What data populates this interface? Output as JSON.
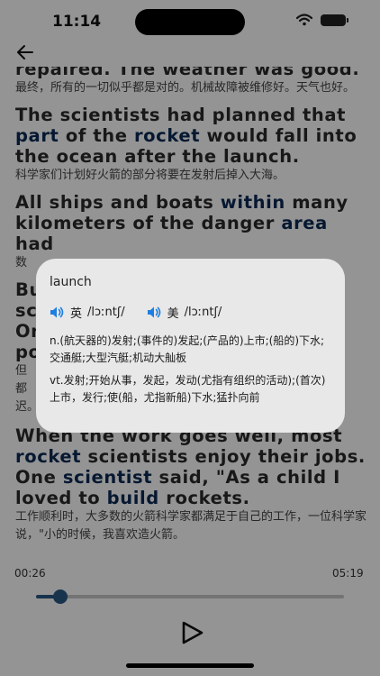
{
  "status": {
    "time": "11:14"
  },
  "paragraphs": [
    {
      "en": [
        [
          "repaired. The weather was good.",
          false
        ]
      ],
      "zh": "最终，所有的一切似乎都是对的。机械故障被维修好。天气也好。"
    },
    {
      "en": [
        [
          "The scientists had planned that ",
          false
        ],
        [
          "part",
          true
        ],
        [
          " of the ",
          false
        ],
        [
          "rocket",
          true
        ],
        [
          " would fall into the ocean after the launch.",
          false
        ]
      ],
      "zh": "科学家们计划好火箭的部分将要在发射后掉入大海。"
    },
    {
      "en": [
        [
          "All ships and boats ",
          false
        ],
        [
          "within",
          true
        ],
        [
          " many kilometers of the danger ",
          false
        ],
        [
          "area",
          true
        ],
        [
          " had",
          false
        ]
      ],
      "zh": "数"
    },
    {
      "en": [
        [
          "Bu",
          false
        ]
      ],
      "zh": ""
    },
    {
      "en": [
        [
          "sc",
          false
        ]
      ],
      "zh": ""
    },
    {
      "en": [
        [
          "On",
          false
        ]
      ],
      "zh": ""
    },
    {
      "en": [
        [
          "po",
          false
        ]
      ],
      "zh": "但都迟。"
    },
    {
      "en": [
        [
          "When the work goes well, most ",
          false
        ],
        [
          "rocket",
          true
        ],
        [
          " scientists enjoy their jobs. One ",
          false
        ],
        [
          "scientist",
          true
        ],
        [
          " said, \"As a child I loved to ",
          false
        ],
        [
          "build",
          true
        ],
        [
          " rockets.",
          false
        ]
      ],
      "zh": "工作顺利时，大多数的火箭科学家都满足于自己的工作，一位科学家说，\"小的时候，我喜欢造火箭。"
    }
  ],
  "player": {
    "current_time": "00:26",
    "total_time": "05:19",
    "progress": 0.08
  },
  "dictionary": {
    "word": "launch",
    "uk": {
      "label": "英",
      "ipa": "/lɔːntʃ/"
    },
    "us": {
      "label": "美",
      "ipa": "/lɔːntʃ/"
    },
    "definitions": [
      "n.(航天器的)发射;(事件的)发起;(产品的)上市;(船的)下水;交通艇;大型汽艇;机动大舢板",
      "vt.发射;开始从事，发起，发动(尤指有组织的活动);(首次)上市，发行;使(船，尤指新船)下水;猛扑向前"
    ]
  },
  "colors": {
    "accent": "#2a5a86",
    "keyword": "#0b2a55",
    "popup_bg": "#e8e8e8"
  },
  "icons": {
    "back": "arrow-left-icon",
    "speaker": "speaker-icon",
    "play": "play-icon"
  }
}
